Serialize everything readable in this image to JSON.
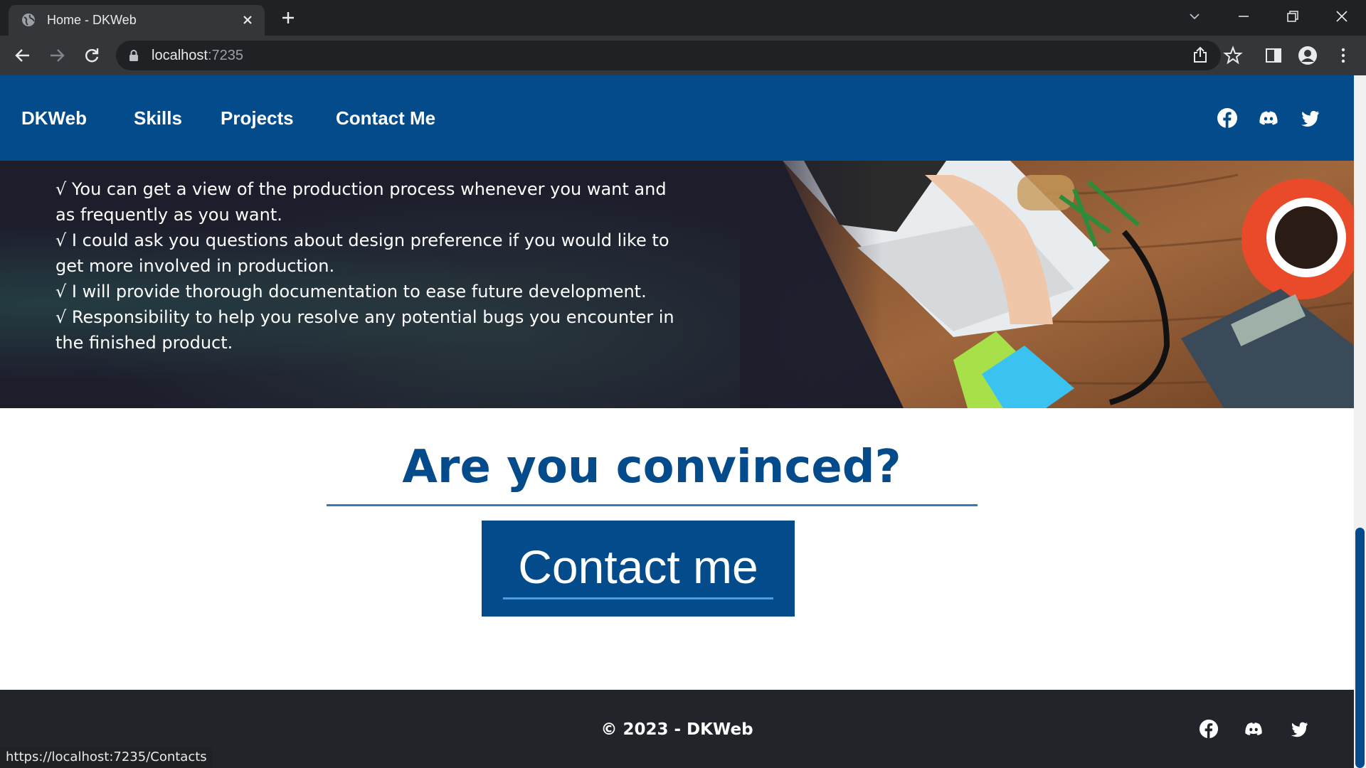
{
  "browser": {
    "tab_title": "Home - DKWeb",
    "url_host": "localhost",
    "url_port": ":7235",
    "status_url": "https://localhost:7235/Contacts"
  },
  "nav": {
    "brand": "DKWeb",
    "links": [
      "Skills",
      "Projects",
      "Contact Me"
    ],
    "social_icons": [
      "facebook-icon",
      "discord-icon",
      "twitter-icon"
    ]
  },
  "hero": {
    "items": [
      "√ You can get a view of the production process whenever you want and as frequently as you want.",
      "√ I could ask you questions about design preference if you would like to get more involved in production.",
      "√ I will provide thorough documentation to ease future development.",
      "√ Responsibility to help you resolve any potential bugs you encounter in the finished product."
    ]
  },
  "cta": {
    "title": "Are you convinced?",
    "button_label": "Contact me"
  },
  "footer": {
    "copyright": "© 2023 - DKWeb"
  },
  "colors": {
    "brand_blue": "#034b8a",
    "footer_bg": "#212529",
    "hero_bg": "#1d1d2c"
  }
}
